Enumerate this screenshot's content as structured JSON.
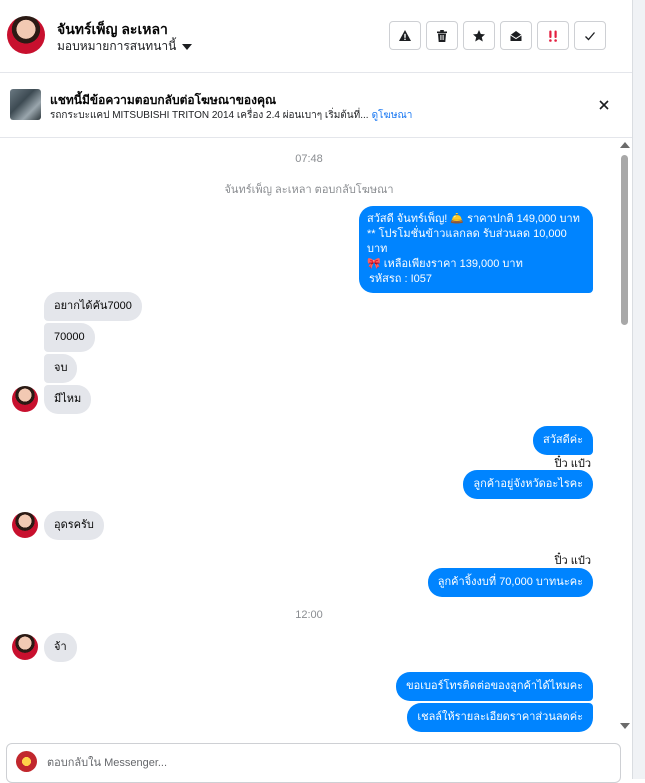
{
  "header": {
    "contact_name": "จันทร์เพ็ญ ละเหลา",
    "assign_label": "มอบหมายการสนทนานี้",
    "actions": [
      {
        "name": "spam-button",
        "icon": "warning-icon",
        "color": "#1c1e21"
      },
      {
        "name": "delete-button",
        "icon": "trash-icon",
        "color": "#1c1e21"
      },
      {
        "name": "star-button",
        "icon": "star-icon",
        "color": "#1c1e21"
      },
      {
        "name": "mark-unread-button",
        "icon": "envelope-open-icon",
        "color": "#1c1e21"
      },
      {
        "name": "follow-up-button",
        "icon": "exclamation-icon",
        "color": "#e41e3f"
      },
      {
        "name": "done-button",
        "icon": "check-icon",
        "color": "#1c1e21"
      }
    ]
  },
  "ad": {
    "title": "แชทนี้มีข้อความตอบกลับต่อโฆษณาของคุณ",
    "subtitle": "รถกระบะแคป MITSUBISHI TRITON 2014 เครื่อง 2.4 ผ่อนเบาๆ เริ่มต้นที่...",
    "link": "ดูโฆษณา"
  },
  "chat": {
    "time1": "07:48",
    "system_notice": "จันทร์เพ็ญ ละเหลา ตอบกลับโฆษณา",
    "outgoing1": [
      "สวัสดี จันทร์เพ็ญ! 🛎️ ราคาปกติ 149,000 บาท",
      "** โปรโมชั่นข้าวแลกลด รับส่วนลด 10,000 บาท",
      "🎀 เหลือเพียงราคา 139,000 บาท",
      "รหัสรถ : I057"
    ],
    "incoming1": [
      "อยากได้คัน7000",
      "70000",
      "จบ",
      "มีไหม"
    ],
    "outgoing2": "สวัสดีค่ะ",
    "sender1": "ปิ๋ว แป๋ว",
    "outgoing3": "ลูกค้าอยู่จังหวัดอะไรคะ",
    "incoming2": "อุดรครับ",
    "sender2": "ปิ๋ว แป๋ว",
    "outgoing4": "ลูกค้าจิ้งงบที่ 70,000  บาทนะคะ",
    "time2": "12:00",
    "incoming3": "จ้า",
    "outgoing5": "ขอเบอร์โทรติดต่อของลูกค้าได้ไหมคะ",
    "outgoing6": "เชลล์ให้รายละเอียดราคาส่วนลดค่ะ"
  },
  "composer": {
    "placeholder": "ตอบกลับใน Messenger..."
  },
  "colors": {
    "outgoing_bubble": "#0084ff",
    "incoming_bubble": "#e4e6eb",
    "link": "#1877f2"
  }
}
